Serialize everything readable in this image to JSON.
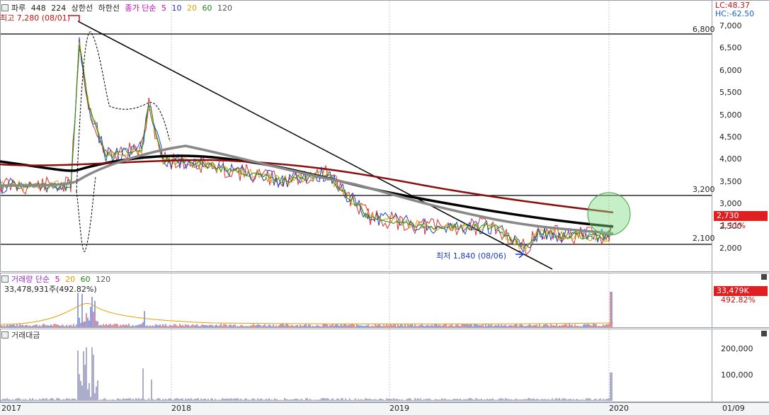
{
  "price_header": {
    "stock": "파루",
    "fields": [
      "448",
      "224",
      "상한선",
      "하한선"
    ],
    "ma_label": "종가 단순",
    "ma_periods": [
      "5",
      "10",
      "20",
      "60",
      "120"
    ],
    "ma_colors": [
      "#cc00cc",
      "#2a2ad0",
      "#e0a000",
      "#1a8a1a",
      "#555555"
    ]
  },
  "indicators": {
    "lc": "LC:48.37",
    "hc": "HC:-62.50"
  },
  "annotations": {
    "high": "최고 7,280 (08/01)",
    "low": "최저 1,840 (08/06)"
  },
  "price_axis": [
    "7,000",
    "6,500",
    "6,000",
    "5,500",
    "5,000",
    "4,500",
    "4,000",
    "3,500",
    "3,000",
    "2,500",
    "2,000"
  ],
  "levels": [
    "6,800",
    "3,200",
    "2,100"
  ],
  "current_price": {
    "label": "2,730",
    "change": "1.11%",
    "color": "#e02020"
  },
  "volume_header": {
    "title": "거래량 단순",
    "periods": [
      "5",
      "20",
      "60",
      "120"
    ],
    "value": "33,478,931주(492.82%)"
  },
  "volume_axis": {
    "box": "33,479K",
    "pct": "492.82%"
  },
  "amount_header": {
    "title": "거래대금"
  },
  "amount_axis": [
    "200,000",
    "100,000"
  ],
  "x_axis": [
    "2017",
    "2018",
    "2019",
    "2020",
    "01/09"
  ]
}
